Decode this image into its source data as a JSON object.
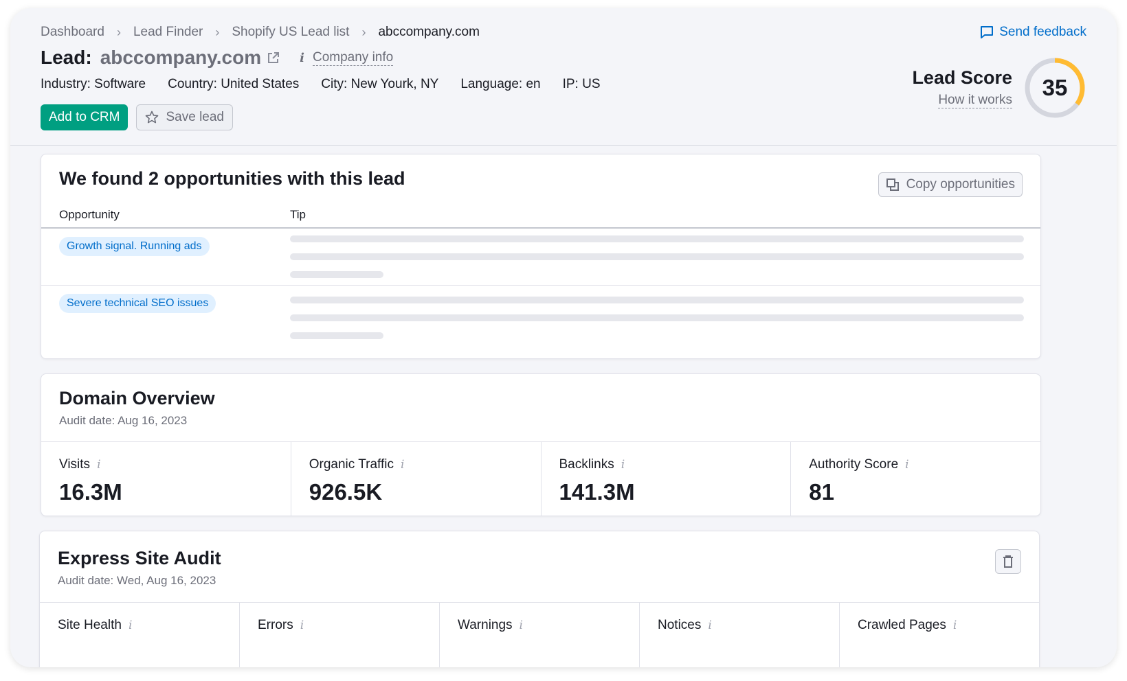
{
  "breadcrumb": [
    "Dashboard",
    "Lead Finder",
    "Shopify US Lead list",
    "abccompany.com"
  ],
  "feedback_label": "Send feedback",
  "lead": {
    "label": "Lead:",
    "domain": "abccompany.com",
    "company_info": "Company info",
    "meta": [
      "Industry: Software",
      "Country: United States",
      "City: New Yourk, NY",
      "Language: en",
      "IP: US"
    ]
  },
  "actions": {
    "add_crm": "Add to CRM",
    "save_lead": "Save lead"
  },
  "score": {
    "title": "Lead Score",
    "link": "How it works",
    "value": "35",
    "ring_fill": 0.35,
    "ring_color": "#ffbb33",
    "track_color": "#d4d6de"
  },
  "opportunities": {
    "title": "We found 2 opportunities with this lead",
    "copy_label": "Copy opportunities",
    "col_opportunity": "Opportunity",
    "col_tip": "Tip",
    "rows": [
      {
        "tag": "Growth signal. Running ads"
      },
      {
        "tag": "Severe technical SEO issues"
      }
    ]
  },
  "domain_overview": {
    "title": "Domain Overview",
    "audit_date": "Audit date: Aug 16, 2023",
    "metrics": [
      {
        "label": "Visits",
        "value": "16.3M"
      },
      {
        "label": "Organic Traffic",
        "value": "926.5K"
      },
      {
        "label": "Backlinks",
        "value": "141.3M"
      },
      {
        "label": "Authority Score",
        "value": "81"
      }
    ]
  },
  "site_audit": {
    "title": "Express Site Audit",
    "audit_date": "Audit date: Wed, Aug 16, 2023",
    "metrics": [
      "Site Health",
      "Errors",
      "Warnings",
      "Notices",
      "Crawled Pages"
    ]
  },
  "colors": {
    "accent": "#006dca",
    "primary_button": "#009f81",
    "tag_bg": "#e0f0ff"
  },
  "icons": {
    "external": "external-link-icon",
    "info": "info-icon",
    "star": "star-icon",
    "copy": "copy-icon",
    "feedback": "chat-bubble-icon",
    "trash": "trash-icon"
  }
}
